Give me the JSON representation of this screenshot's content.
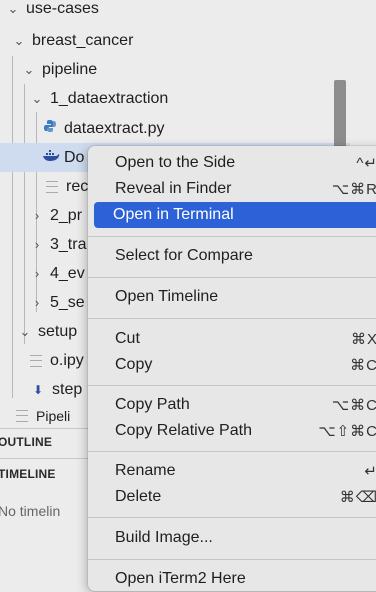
{
  "explorer": {
    "tree": [
      {
        "label": "use-cases"
      },
      {
        "label": "breast_cancer"
      },
      {
        "label": "pipeline"
      },
      {
        "label": "1_dataextraction"
      },
      {
        "label": "dataextract.py"
      },
      {
        "label": "Do"
      },
      {
        "label": "rec"
      },
      {
        "label": "2_pr"
      },
      {
        "label": "3_tra"
      },
      {
        "label": "4_ev"
      },
      {
        "label": "5_se"
      },
      {
        "label": "setup"
      },
      {
        "label": "o.ipy"
      },
      {
        "label": "step"
      },
      {
        "label": "Pipeli"
      }
    ],
    "sections": {
      "outline": "OUTLINE",
      "timeline": "TIMELINE"
    },
    "timeline_empty": "No timelin"
  },
  "context_menu": {
    "items": [
      {
        "label": "Open to the Side",
        "shortcut": "^↵"
      },
      {
        "label": "Reveal in Finder",
        "shortcut": "⌥⌘R"
      },
      {
        "label": "Open in Terminal",
        "shortcut": ""
      },
      {
        "label": "Select for Compare",
        "shortcut": ""
      },
      {
        "label": "Open Timeline",
        "shortcut": ""
      },
      {
        "label": "Cut",
        "shortcut": "⌘X"
      },
      {
        "label": "Copy",
        "shortcut": "⌘C"
      },
      {
        "label": "Copy Path",
        "shortcut": "⌥⌘C"
      },
      {
        "label": "Copy Relative Path",
        "shortcut": "⌥⇧⌘C"
      },
      {
        "label": "Rename",
        "shortcut": "↵"
      },
      {
        "label": "Delete",
        "shortcut": "⌘⌫"
      },
      {
        "label": "Build Image...",
        "shortcut": ""
      },
      {
        "label": "Open iTerm2 Here",
        "shortcut": ""
      }
    ]
  },
  "colors": {
    "highlight": "#2d61d8",
    "selected_row": "#cfdcef",
    "python_icon": "#3b7bbf",
    "notebook_icon": "#2d4f9e"
  }
}
